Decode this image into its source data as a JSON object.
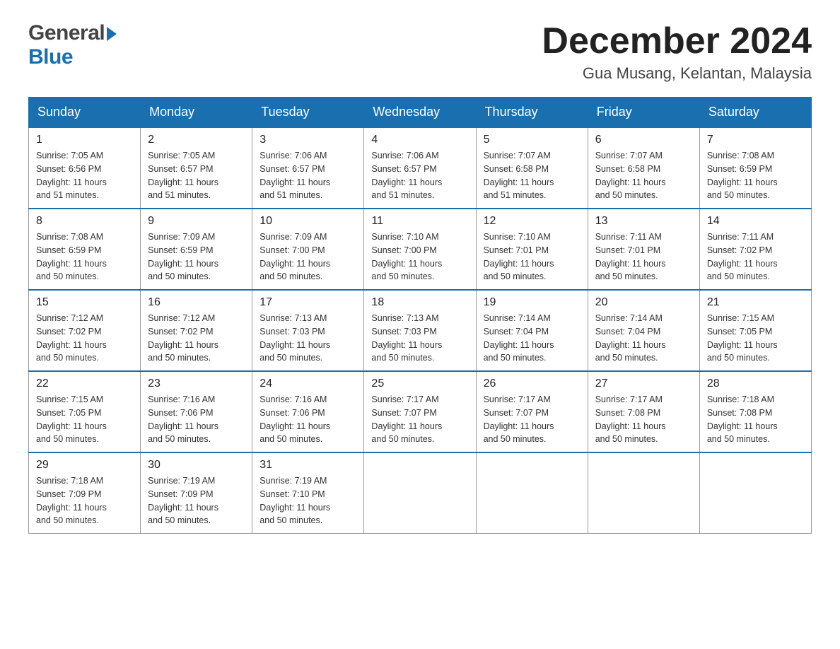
{
  "header": {
    "logo_general": "General",
    "logo_blue": "Blue",
    "month_title": "December 2024",
    "location": "Gua Musang, Kelantan, Malaysia"
  },
  "days_of_week": [
    "Sunday",
    "Monday",
    "Tuesday",
    "Wednesday",
    "Thursday",
    "Friday",
    "Saturday"
  ],
  "weeks": [
    [
      {
        "day": "1",
        "sunrise": "7:05 AM",
        "sunset": "6:56 PM",
        "daylight": "11 hours and 51 minutes."
      },
      {
        "day": "2",
        "sunrise": "7:05 AM",
        "sunset": "6:57 PM",
        "daylight": "11 hours and 51 minutes."
      },
      {
        "day": "3",
        "sunrise": "7:06 AM",
        "sunset": "6:57 PM",
        "daylight": "11 hours and 51 minutes."
      },
      {
        "day": "4",
        "sunrise": "7:06 AM",
        "sunset": "6:57 PM",
        "daylight": "11 hours and 51 minutes."
      },
      {
        "day": "5",
        "sunrise": "7:07 AM",
        "sunset": "6:58 PM",
        "daylight": "11 hours and 51 minutes."
      },
      {
        "day": "6",
        "sunrise": "7:07 AM",
        "sunset": "6:58 PM",
        "daylight": "11 hours and 50 minutes."
      },
      {
        "day": "7",
        "sunrise": "7:08 AM",
        "sunset": "6:59 PM",
        "daylight": "11 hours and 50 minutes."
      }
    ],
    [
      {
        "day": "8",
        "sunrise": "7:08 AM",
        "sunset": "6:59 PM",
        "daylight": "11 hours and 50 minutes."
      },
      {
        "day": "9",
        "sunrise": "7:09 AM",
        "sunset": "6:59 PM",
        "daylight": "11 hours and 50 minutes."
      },
      {
        "day": "10",
        "sunrise": "7:09 AM",
        "sunset": "7:00 PM",
        "daylight": "11 hours and 50 minutes."
      },
      {
        "day": "11",
        "sunrise": "7:10 AM",
        "sunset": "7:00 PM",
        "daylight": "11 hours and 50 minutes."
      },
      {
        "day": "12",
        "sunrise": "7:10 AM",
        "sunset": "7:01 PM",
        "daylight": "11 hours and 50 minutes."
      },
      {
        "day": "13",
        "sunrise": "7:11 AM",
        "sunset": "7:01 PM",
        "daylight": "11 hours and 50 minutes."
      },
      {
        "day": "14",
        "sunrise": "7:11 AM",
        "sunset": "7:02 PM",
        "daylight": "11 hours and 50 minutes."
      }
    ],
    [
      {
        "day": "15",
        "sunrise": "7:12 AM",
        "sunset": "7:02 PM",
        "daylight": "11 hours and 50 minutes."
      },
      {
        "day": "16",
        "sunrise": "7:12 AM",
        "sunset": "7:02 PM",
        "daylight": "11 hours and 50 minutes."
      },
      {
        "day": "17",
        "sunrise": "7:13 AM",
        "sunset": "7:03 PM",
        "daylight": "11 hours and 50 minutes."
      },
      {
        "day": "18",
        "sunrise": "7:13 AM",
        "sunset": "7:03 PM",
        "daylight": "11 hours and 50 minutes."
      },
      {
        "day": "19",
        "sunrise": "7:14 AM",
        "sunset": "7:04 PM",
        "daylight": "11 hours and 50 minutes."
      },
      {
        "day": "20",
        "sunrise": "7:14 AM",
        "sunset": "7:04 PM",
        "daylight": "11 hours and 50 minutes."
      },
      {
        "day": "21",
        "sunrise": "7:15 AM",
        "sunset": "7:05 PM",
        "daylight": "11 hours and 50 minutes."
      }
    ],
    [
      {
        "day": "22",
        "sunrise": "7:15 AM",
        "sunset": "7:05 PM",
        "daylight": "11 hours and 50 minutes."
      },
      {
        "day": "23",
        "sunrise": "7:16 AM",
        "sunset": "7:06 PM",
        "daylight": "11 hours and 50 minutes."
      },
      {
        "day": "24",
        "sunrise": "7:16 AM",
        "sunset": "7:06 PM",
        "daylight": "11 hours and 50 minutes."
      },
      {
        "day": "25",
        "sunrise": "7:17 AM",
        "sunset": "7:07 PM",
        "daylight": "11 hours and 50 minutes."
      },
      {
        "day": "26",
        "sunrise": "7:17 AM",
        "sunset": "7:07 PM",
        "daylight": "11 hours and 50 minutes."
      },
      {
        "day": "27",
        "sunrise": "7:17 AM",
        "sunset": "7:08 PM",
        "daylight": "11 hours and 50 minutes."
      },
      {
        "day": "28",
        "sunrise": "7:18 AM",
        "sunset": "7:08 PM",
        "daylight": "11 hours and 50 minutes."
      }
    ],
    [
      {
        "day": "29",
        "sunrise": "7:18 AM",
        "sunset": "7:09 PM",
        "daylight": "11 hours and 50 minutes."
      },
      {
        "day": "30",
        "sunrise": "7:19 AM",
        "sunset": "7:09 PM",
        "daylight": "11 hours and 50 minutes."
      },
      {
        "day": "31",
        "sunrise": "7:19 AM",
        "sunset": "7:10 PM",
        "daylight": "11 hours and 50 minutes."
      },
      null,
      null,
      null,
      null
    ]
  ],
  "labels": {
    "sunrise": "Sunrise:",
    "sunset": "Sunset:",
    "daylight": "Daylight:"
  }
}
